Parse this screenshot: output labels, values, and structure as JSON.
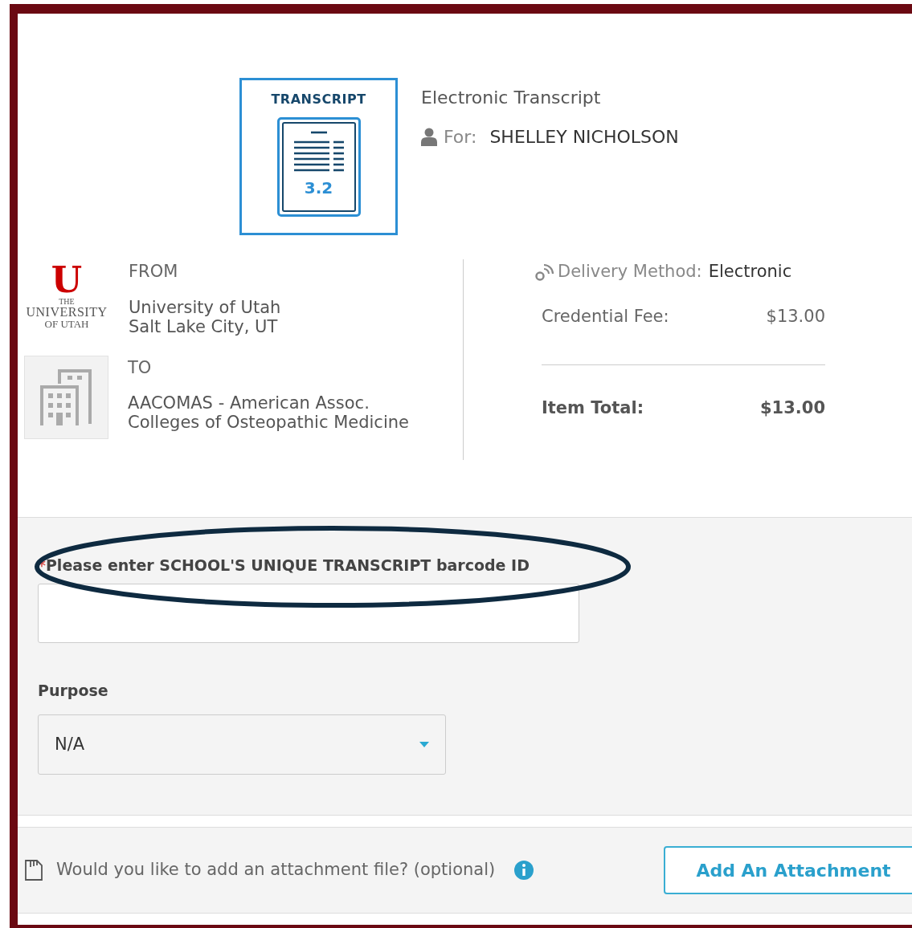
{
  "product": {
    "badge_title": "TRANSCRIPT",
    "badge_version": "3.2",
    "title": "Electronic Transcript",
    "for_label": "For:",
    "for_name": "SHELLEY NICHOLSON"
  },
  "from": {
    "heading": "FROM",
    "logo": {
      "mark": "U",
      "line1": "THE",
      "line2": "UNIVERSITY",
      "line3": "OF UTAH"
    },
    "name": "University of Utah",
    "place": "Salt Lake City, UT"
  },
  "to": {
    "heading": "TO",
    "line1": "AACOMAS - American Assoc.",
    "line2": "Colleges of Osteopathic Medicine"
  },
  "delivery": {
    "label": "Delivery Method:",
    "value": "Electronic"
  },
  "fees": [
    {
      "kind": "fee",
      "label": "Credential Fee:",
      "amount": "$13.00"
    },
    {
      "kind": "total",
      "label": "Item Total:",
      "amount": "$13.00"
    }
  ],
  "barcode_field": {
    "required_mark": "*",
    "label": "Please enter SCHOOL'S UNIQUE TRANSCRIPT barcode ID",
    "highlighted": true
  },
  "purpose": {
    "label": "Purpose",
    "value": "N/A"
  },
  "attachment": {
    "question": "Would you like to add an attachment file? (optional)",
    "button": "Add An Attachment"
  }
}
